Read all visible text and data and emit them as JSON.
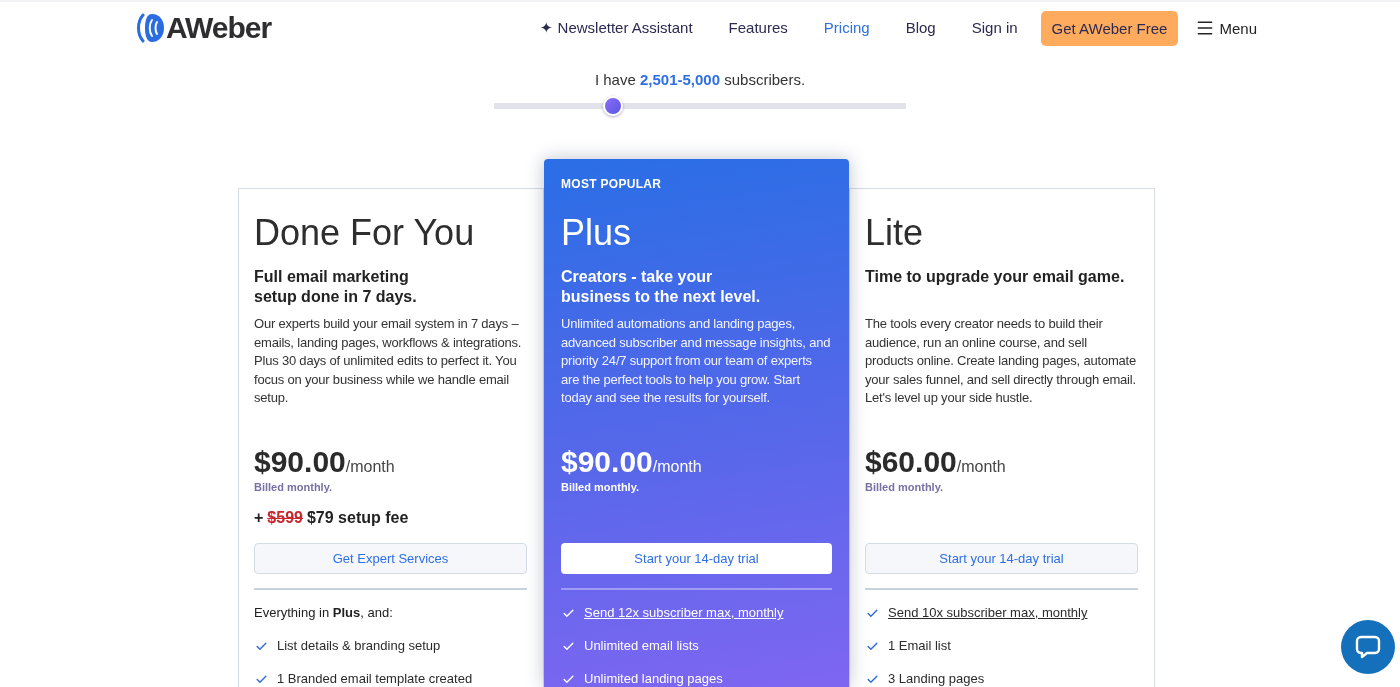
{
  "header": {
    "logo": "AWeber",
    "nav": [
      {
        "label": "✦ Newsletter Assistant",
        "selected": false
      },
      {
        "label": "Features",
        "selected": false
      },
      {
        "label": "Pricing",
        "selected": true
      },
      {
        "label": "Blog",
        "selected": false
      },
      {
        "label": "Sign in",
        "selected": false
      }
    ],
    "cta": "Get AWeber Free",
    "menu": "Menu"
  },
  "slider": {
    "text": "I have **2,501-5,000** subscribers.",
    "level": 0.29
  },
  "plans": [
    {
      "highlighted": false,
      "name": "Done For You",
      "tagline": "Full email marketing\nsetup done in 7 days.",
      "description": "Our experts build your email system in 7 days – emails, landing pages, workflows & integrations. Plus 30 days of unlimited edits to perfect it. You focus on your business while we handle email setup.",
      "price": "$90.00",
      "period": "/month",
      "billing": "Billed monthly.",
      "setup_fee": {
        "prefix": "+",
        "old_price": "$599",
        "price": "$79 setup fee"
      },
      "button": "Get Expert Services",
      "features_intro": "Everything in **Plus**, and:",
      "features": [
        {
          "text": "List details & branding setup",
          "link": false
        },
        {
          "text": "1 Branded email template created",
          "link": false
        }
      ]
    },
    {
      "highlighted": true,
      "badge": "MOST POPULAR",
      "name": "Plus",
      "tagline": "Creators - take your\nbusiness to the next level.",
      "description": "Unlimited automations and landing pages, advanced subscriber and message insights, and priority 24/7 support from our team of experts are the perfect tools to help you grow. Start today and see the results for yourself.",
      "price": "$90.00",
      "period": "/month",
      "billing": "Billed monthly.",
      "button": "Start your 14-day trial",
      "features": [
        {
          "text": "Send 12x subscriber max, monthly",
          "link": true
        },
        {
          "text": "Unlimited email lists",
          "link": false
        },
        {
          "text": "Unlimited landing pages",
          "link": false
        }
      ]
    },
    {
      "highlighted": false,
      "name": "Lite",
      "tagline": "Time to upgrade your email game.",
      "description": "The tools every creator needs to build their audience, run an online course, and sell products online. Create landing pages, automate your sales funnel, and sell directly through email. Let's level up your side hustle.",
      "price": "$60.00",
      "period": "/month",
      "billing": "Billed monthly.",
      "button": "Start your 14-day trial",
      "features": [
        {
          "text": "Send 10x subscriber max, monthly",
          "link": true
        },
        {
          "text": "1 Email list",
          "link": false
        },
        {
          "text": "3 Landing pages",
          "link": false
        }
      ]
    }
  ]
}
